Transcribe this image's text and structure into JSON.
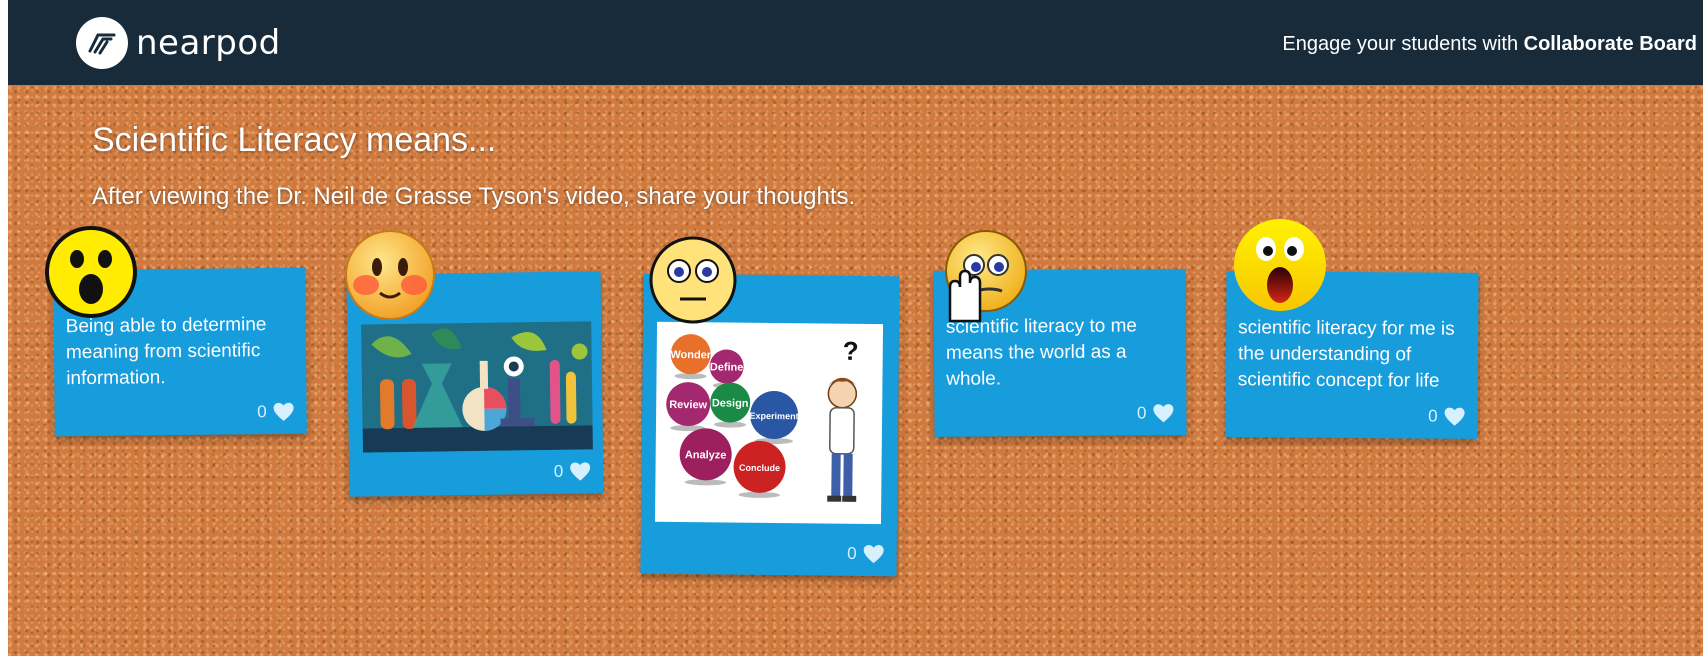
{
  "header": {
    "logo_text": "nearpod",
    "tagline_prefix": "Engage your students with ",
    "tagline_bold": "Collaborate Board"
  },
  "board": {
    "title": "Scientific Literacy means...",
    "subtitle": "After viewing the Dr. Neil de Grasse Tyson's video, share your thoughts."
  },
  "cards": [
    {
      "text": "Being able to determine meaning from scientific information.",
      "likes": "0",
      "emoji": "shocked-face-icon"
    },
    {
      "image": "science-illustration",
      "likes": "0",
      "emoji": "blushing-face-icon"
    },
    {
      "image": "scientific-process-diagram",
      "diagram_labels": [
        "Wonder",
        "Define",
        "Review",
        "Design",
        "Experiment",
        "Analyze",
        "Conclude"
      ],
      "diagram_mark": "?",
      "likes": "0",
      "emoji": "neutral-face-icon"
    },
    {
      "text": "scientific literacy to me means the world as a whole.",
      "likes": "0",
      "emoji": "thinking-face-icon"
    },
    {
      "text": "scientific literacy for me is the understanding of scientific concept for life",
      "likes": "0",
      "emoji": "screaming-face-icon"
    }
  ],
  "colors": {
    "topbar": "#172b3a",
    "card": "#179cdc",
    "cork": "#d07a3f",
    "diagram_circles": [
      "#e8702a",
      "#a4286f",
      "#a4286f",
      "#1a8a46",
      "#2a57a4",
      "#9c1f5e",
      "#cc2222"
    ]
  }
}
